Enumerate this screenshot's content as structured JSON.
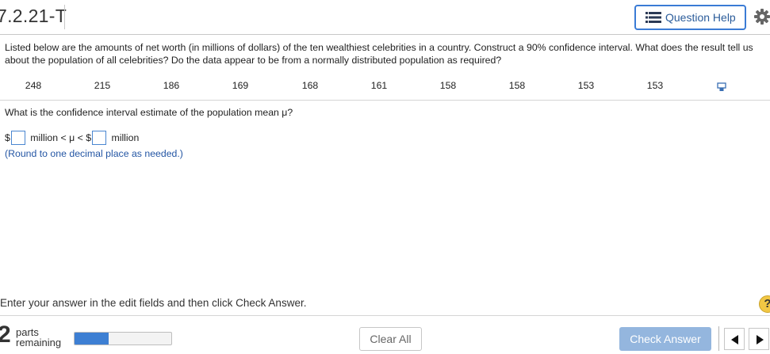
{
  "header": {
    "question_id": "7.2.21-T",
    "help_label": "Question Help",
    "help_icon": "list-icon",
    "settings_icon": "gear-icon"
  },
  "question": {
    "text": "Listed below are the amounts of net worth (in millions of dollars) of the ten wealthiest celebrities in a country. Construct a 90% confidence interval. What does the result tell us about the population of all celebrities? Do the data appear to be from a normally distributed population as required?",
    "data_values": [
      "248",
      "215",
      "186",
      "169",
      "168",
      "161",
      "158",
      "158",
      "153",
      "153"
    ],
    "copy_icon": "copy-data-icon"
  },
  "part": {
    "prompt": "What is the confidence interval estimate of the population mean μ?",
    "answer": {
      "prefix": "$",
      "middle": " million < μ < $",
      "suffix": " million",
      "lower_value": "",
      "upper_value": ""
    },
    "round_note": "(Round to one decimal place as needed.)"
  },
  "footer": {
    "instruction": "Enter your answer in the edit fields and then click Check Answer.",
    "help_symbol": "?",
    "parts_count": "2",
    "parts_label_1": "parts",
    "parts_label_2": "remaining",
    "progress_fraction": 0.35,
    "clear_label": "Clear All",
    "check_label": "Check Answer"
  },
  "colors": {
    "accent": "#3a7bd5",
    "progress": "#3d7fd3",
    "check_button": "#94b6de",
    "note_text": "#2456a4",
    "help_circle": "#f2c744"
  }
}
